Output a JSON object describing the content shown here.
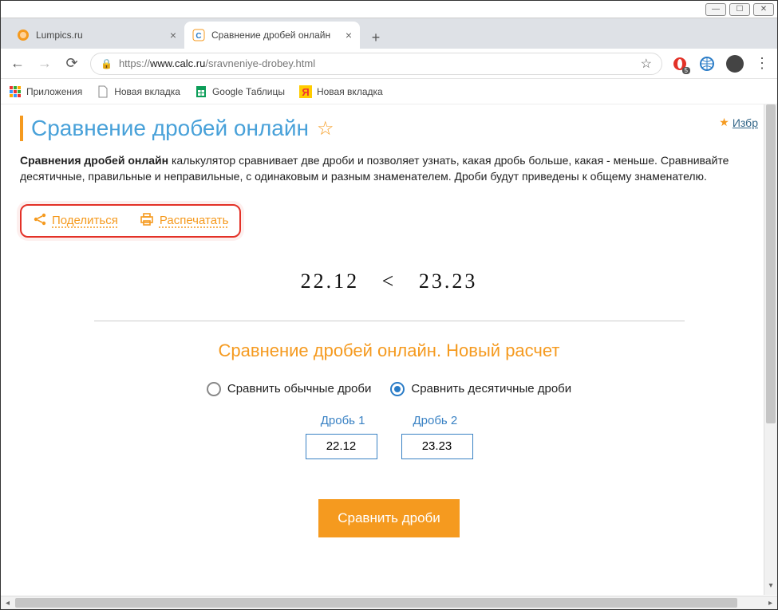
{
  "window": {
    "tabs": [
      {
        "title": "Lumpics.ru",
        "active": false,
        "favicon_color": "#f59a1f"
      },
      {
        "title": "Сравнение дробей онлайн",
        "active": true,
        "favicon_color": "#2a7cc7"
      }
    ]
  },
  "toolbar": {
    "url_scheme": "https://",
    "url_host": "www.calc.ru",
    "url_path": "/sravneniye-drobey.html",
    "ext_badge": "5"
  },
  "bookmarks": [
    {
      "label": "Приложения",
      "icon": "apps"
    },
    {
      "label": "Новая вкладка",
      "icon": "page"
    },
    {
      "label": "Google Таблицы",
      "icon": "sheets"
    },
    {
      "label": "Новая вкладка",
      "icon": "yandex"
    }
  ],
  "page": {
    "title": "Сравнение дробей онлайн",
    "fav_label": "Избр",
    "desc_bold": "Сравнения дробей онлайн",
    "desc_rest": " калькулятор сравнивает две дроби и позволяет узнать, какая дробь больше, какая - меньше. Сравнивайте десятичные, правильные и неправильные, с одинаковым и разным знаменателем. Дроби будут приведены к общему знаменателю.",
    "share_label": "Поделиться",
    "print_label": "Распечатать",
    "result_left": "22.12",
    "result_op": "<",
    "result_right": "23.23",
    "section_title": "Сравнение дробей онлайн. Новый расчет",
    "radio1": "Сравнить обычные дроби",
    "radio2": "Сравнить десятичные дроби",
    "col1": "Дробь 1",
    "col2": "Дробь 2",
    "input1": "22.12",
    "input2": "23.23",
    "submit": "Сравнить дроби"
  }
}
